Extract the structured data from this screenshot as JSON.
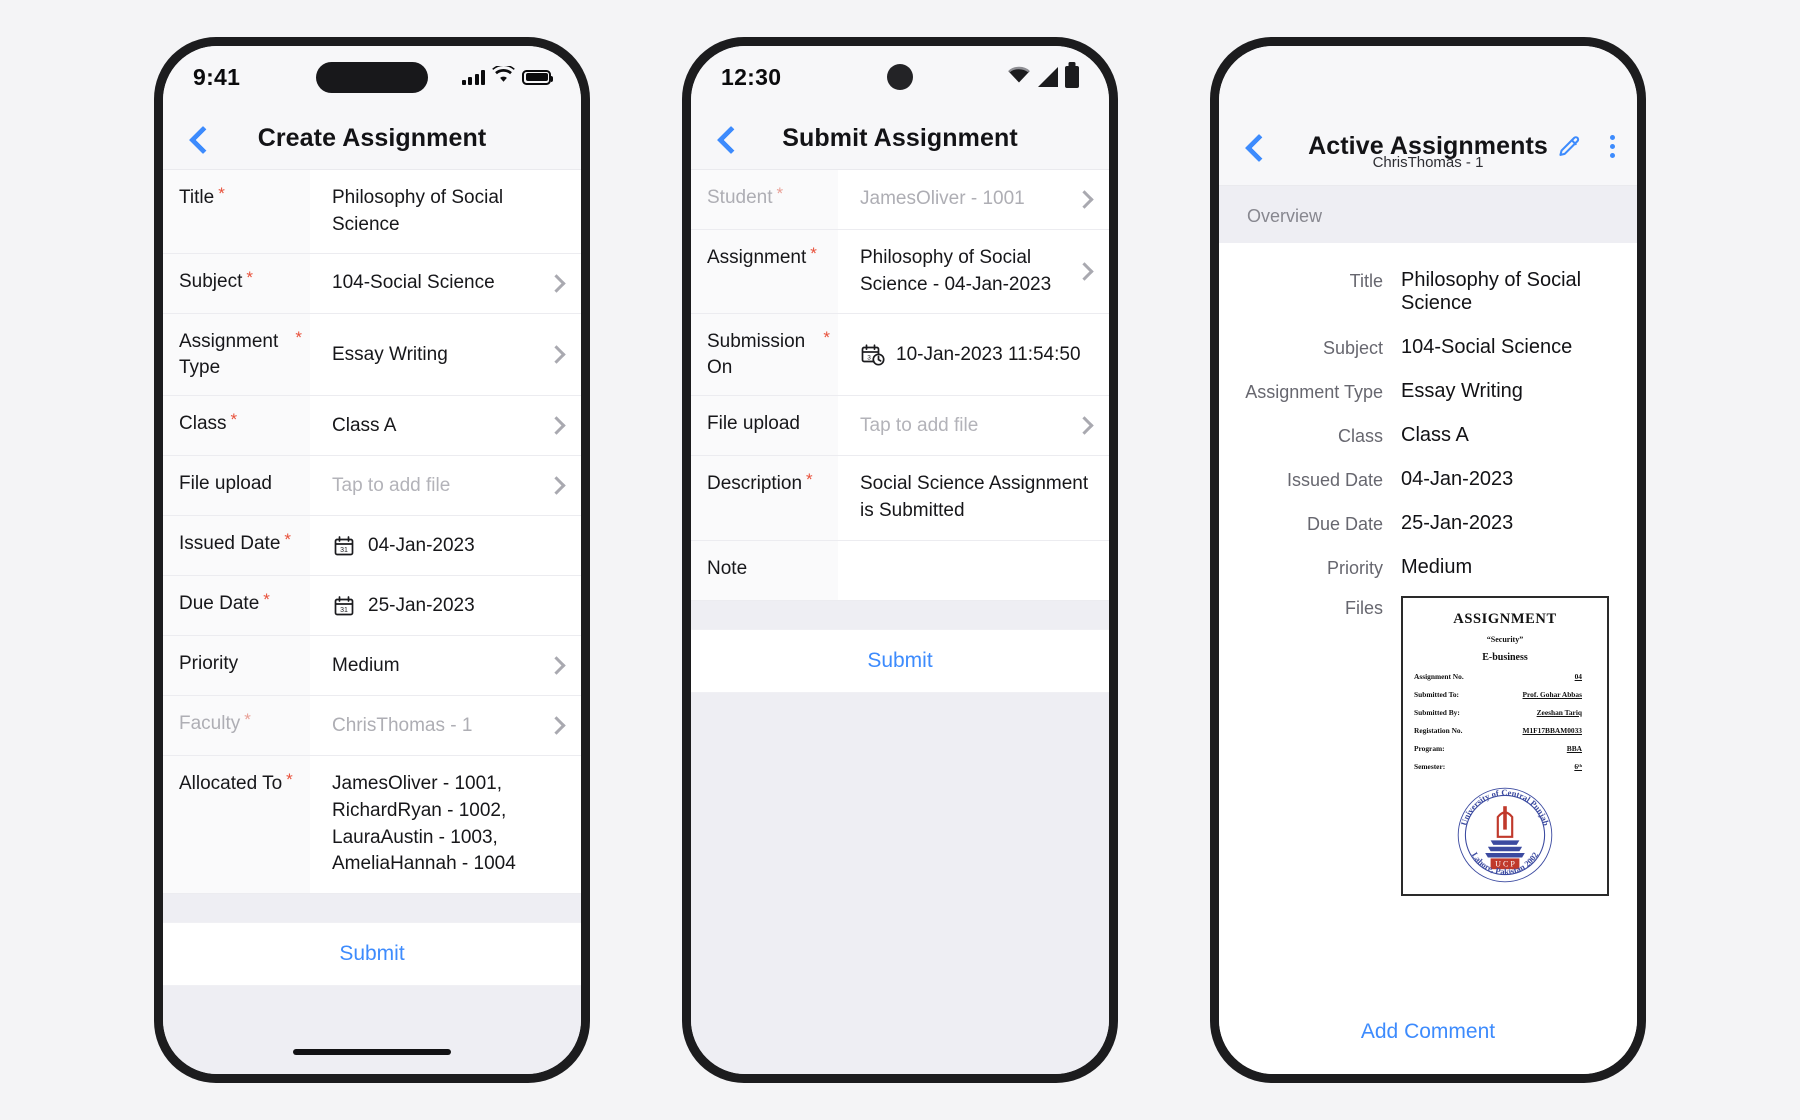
{
  "phone1": {
    "statusbar": {
      "time": "9:41",
      "icons": [
        "cellular-bars",
        "wifi",
        "battery"
      ]
    },
    "nav": {
      "title": "Create Assignment",
      "back_icon": "chevron-left-icon"
    },
    "rows": [
      {
        "label": "Title",
        "required": true,
        "value": "Philosophy of Social Science",
        "chevron": false,
        "icon": null,
        "placeholder": false,
        "muted": false
      },
      {
        "label": "Subject",
        "required": true,
        "value": "104-Social Science",
        "chevron": true,
        "icon": null,
        "placeholder": false,
        "muted": false
      },
      {
        "label": "Assignment Type",
        "required": true,
        "value": "Essay Writing",
        "chevron": true,
        "icon": null,
        "placeholder": false,
        "muted": false
      },
      {
        "label": "Class",
        "required": true,
        "value": "Class A",
        "chevron": true,
        "icon": null,
        "placeholder": false,
        "muted": false
      },
      {
        "label": "File upload",
        "required": false,
        "value": "Tap to add file",
        "chevron": true,
        "icon": null,
        "placeholder": true,
        "muted": false
      },
      {
        "label": "Issued Date",
        "required": true,
        "value": "04-Jan-2023",
        "chevron": false,
        "icon": "calendar-icon",
        "placeholder": false,
        "muted": false
      },
      {
        "label": "Due Date",
        "required": true,
        "value": "25-Jan-2023",
        "chevron": false,
        "icon": "calendar-icon",
        "placeholder": false,
        "muted": false
      },
      {
        "label": "Priority",
        "required": false,
        "value": "Medium",
        "chevron": true,
        "icon": null,
        "placeholder": false,
        "muted": false
      },
      {
        "label": "Faculty",
        "required": true,
        "value": "ChrisThomas - 1",
        "chevron": true,
        "icon": null,
        "placeholder": false,
        "muted": true
      },
      {
        "label": "Allocated To",
        "required": true,
        "value": "JamesOliver - 1001, RichardRyan - 1002, LauraAustin - 1003, AmeliaHannah - 1004",
        "chevron": false,
        "icon": null,
        "placeholder": false,
        "muted": false
      }
    ],
    "submit_label": "Submit"
  },
  "phone2": {
    "statusbar": {
      "time": "12:30",
      "icons": [
        "wifi",
        "signal",
        "battery"
      ]
    },
    "nav": {
      "title": "Submit Assignment",
      "back_icon": "chevron-left-icon"
    },
    "rows": [
      {
        "label": "Student",
        "required": true,
        "value": "JamesOliver - 1001",
        "chevron": true,
        "icon": null,
        "placeholder": false,
        "muted": true
      },
      {
        "label": "Assignment",
        "required": true,
        "value": "Philosophy of Social Science - 04-Jan-2023",
        "chevron": true,
        "icon": null,
        "placeholder": false,
        "muted": false
      },
      {
        "label": "Submission On",
        "required": true,
        "value": "10-Jan-2023 11:54:50",
        "chevron": false,
        "icon": "calendar-clock-icon",
        "placeholder": false,
        "muted": false
      },
      {
        "label": "File upload",
        "required": false,
        "value": "Tap to add file",
        "chevron": true,
        "icon": null,
        "placeholder": true,
        "muted": false
      },
      {
        "label": "Description",
        "required": true,
        "value": "Social Science Assignment is Submitted",
        "chevron": false,
        "icon": null,
        "placeholder": false,
        "muted": false
      },
      {
        "label": "Note",
        "required": false,
        "value": "",
        "chevron": false,
        "icon": null,
        "placeholder": false,
        "muted": false
      }
    ],
    "submit_label": "Submit"
  },
  "phone3": {
    "nav": {
      "title": "Active Assignments",
      "subtitle": "ChrisThomas - 1",
      "back_icon": "chevron-left-icon",
      "edit_icon": "pencil-icon",
      "menu_icon": "kebab-menu-icon"
    },
    "section_label": "Overview",
    "details": [
      {
        "label": "Title",
        "value": "Philosophy of Social Science"
      },
      {
        "label": "Subject",
        "value": "104-Social Science"
      },
      {
        "label": "Assignment Type",
        "value": "Essay Writing"
      },
      {
        "label": "Class",
        "value": "Class A"
      },
      {
        "label": "Issued Date",
        "value": "04-Jan-2023"
      },
      {
        "label": "Due Date",
        "value": "25-Jan-2023"
      },
      {
        "label": "Priority",
        "value": "Medium"
      },
      {
        "label": "Files",
        "value": ""
      }
    ],
    "document": {
      "title": "ASSIGNMENT",
      "quote": "“Security”",
      "subject": "E-business",
      "fields": [
        {
          "key": "Assignment No.",
          "value": "04"
        },
        {
          "key": "Submitted To:",
          "value": "Prof. Gohar Abbas"
        },
        {
          "key": "Submitted By:",
          "value": "Zeeshan Tariq"
        },
        {
          "key": "Registation No.",
          "value": "M1F17BBAM0033"
        },
        {
          "key": "Program:",
          "value": "BBA"
        },
        {
          "key": "Semester:",
          "value": "6ᵗʰ"
        }
      ],
      "logo": {
        "name": "university-of-central-punjab-logo",
        "top_text": "University of Central Punjab",
        "bottom_text": "Lahore, Pakistan 2002",
        "monogram": "U C P"
      }
    },
    "add_comment_label": "Add Comment"
  },
  "colors": {
    "accent_blue": "#3d8bfd",
    "required_red": "#e8503a",
    "label_gray": "#67676f",
    "placeholder_gray": "#b3b3b9",
    "strip_gray": "#eeeef3",
    "page_bg": "#f4f4f6"
  }
}
